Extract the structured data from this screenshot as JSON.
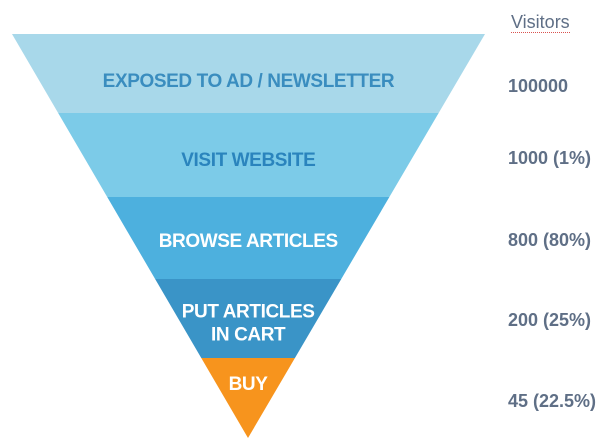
{
  "header": {
    "visitors_label": "Visitors"
  },
  "stages": [
    {
      "lines": [
        "EXPOSED TO AD / NEWSLETTER"
      ],
      "value": "100000",
      "color": "#a8d8ea",
      "text_color": "#3a8dbf"
    },
    {
      "lines": [
        "VISIT WEBSITE"
      ],
      "value": "1000 (1%)",
      "color": "#7ccbe8",
      "text_color": "#2a84bd"
    },
    {
      "lines": [
        "BROWSE ARTICLES"
      ],
      "value": "800 (80%)",
      "color": "#4db0de",
      "text_color": "#ffffff"
    },
    {
      "lines": [
        "PUT ARTICLES",
        "IN CART"
      ],
      "value": "200 (25%)",
      "color": "#3a94c7",
      "text_color": "#ffffff"
    },
    {
      "lines": [
        "BUY"
      ],
      "value": "45 (22.5%)",
      "color": "#f7941d",
      "text_color": "#ffffff"
    }
  ]
}
